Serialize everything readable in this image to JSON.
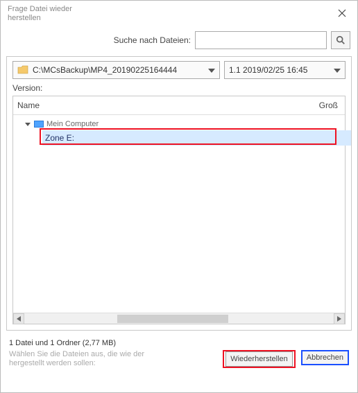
{
  "window": {
    "title": "Frage Datei wieder herstellen"
  },
  "search": {
    "label": "Suche nach Dateien:",
    "value": "",
    "placeholder": ""
  },
  "path_dropdown": {
    "value": "C:\\MCsBackup\\MP4_20190225164444"
  },
  "version_dropdown": {
    "value": "1.1  2019/02/25 16:45"
  },
  "version_label": "Version:",
  "columns": {
    "name": "Name",
    "size": "Groß"
  },
  "tree": {
    "root": {
      "label": "Mein Computer",
      "expanded": true
    },
    "child": {
      "label": "Zone E:",
      "selected": true
    }
  },
  "status": "1 Datei und 1 Ordner (2,77 MB)",
  "hint": "Wählen Sie die Dateien aus, die wie der hergestellt werden sollen:",
  "buttons": {
    "restore": "Wiederherstellen",
    "cancel": "Abbrechen"
  }
}
